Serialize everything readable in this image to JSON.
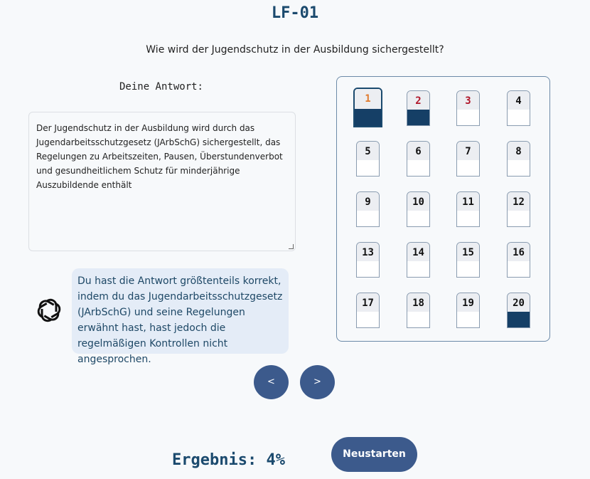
{
  "header": {
    "title": "LF-01"
  },
  "question": "Wie wird der Jugendschutz in der Ausbildung sichergestellt?",
  "answer": {
    "label": "Deine Antwort:",
    "text": "Der Jugendschutz in der Ausbildung wird durch das Jugendarbeitsschutzgesetz (JArbSchG) sichergestellt, das Regelungen zu Arbeitszeiten, Pausen, Überstundenverbot und gesundheitlichem Schutz für minderjährige Auszubildende enthält"
  },
  "feedback": {
    "icon": "openai-logo-icon",
    "text": "Du hast die Antwort größtenteils korrekt, indem du das Jugendarbeitsschutzgesetz (JArbSchG) und seine Regelungen erwähnt hast, hast jedoch die regelmäßigen Kontrollen nicht angesprochen."
  },
  "question_grid": {
    "items": [
      {
        "label": "1",
        "color": "#e07b2e",
        "status": "answered",
        "current": true
      },
      {
        "label": "2",
        "color": "#b0162a",
        "status": "answered",
        "current": false
      },
      {
        "label": "3",
        "color": "#b0162a",
        "status": "open",
        "current": false
      },
      {
        "label": "4",
        "color": "#111111",
        "status": "open",
        "current": false
      },
      {
        "label": "5",
        "color": "#111111",
        "status": "open",
        "current": false
      },
      {
        "label": "6",
        "color": "#111111",
        "status": "open",
        "current": false
      },
      {
        "label": "7",
        "color": "#111111",
        "status": "open",
        "current": false
      },
      {
        "label": "8",
        "color": "#111111",
        "status": "open",
        "current": false
      },
      {
        "label": "9",
        "color": "#111111",
        "status": "open",
        "current": false
      },
      {
        "label": "10",
        "color": "#111111",
        "status": "open",
        "current": false
      },
      {
        "label": "11",
        "color": "#111111",
        "status": "open",
        "current": false
      },
      {
        "label": "12",
        "color": "#111111",
        "status": "open",
        "current": false
      },
      {
        "label": "13",
        "color": "#111111",
        "status": "open",
        "current": false
      },
      {
        "label": "14",
        "color": "#111111",
        "status": "open",
        "current": false
      },
      {
        "label": "15",
        "color": "#111111",
        "status": "open",
        "current": false
      },
      {
        "label": "16",
        "color": "#111111",
        "status": "open",
        "current": false
      },
      {
        "label": "17",
        "color": "#111111",
        "status": "open",
        "current": false
      },
      {
        "label": "18",
        "color": "#111111",
        "status": "open",
        "current": false
      },
      {
        "label": "19",
        "color": "#111111",
        "status": "open",
        "current": false
      },
      {
        "label": "20",
        "color": "#111111",
        "status": "answered",
        "current": false
      }
    ],
    "answered_color": "#153f66"
  },
  "navigation": {
    "prev_label": "<",
    "next_label": ">"
  },
  "result": {
    "text": "Ergebnis: 4%"
  },
  "restart": {
    "label": "Neustarten"
  },
  "colors": {
    "accent": "#3c5a8c",
    "title": "#1b4a6e",
    "bubble": "#e4ecf7"
  }
}
